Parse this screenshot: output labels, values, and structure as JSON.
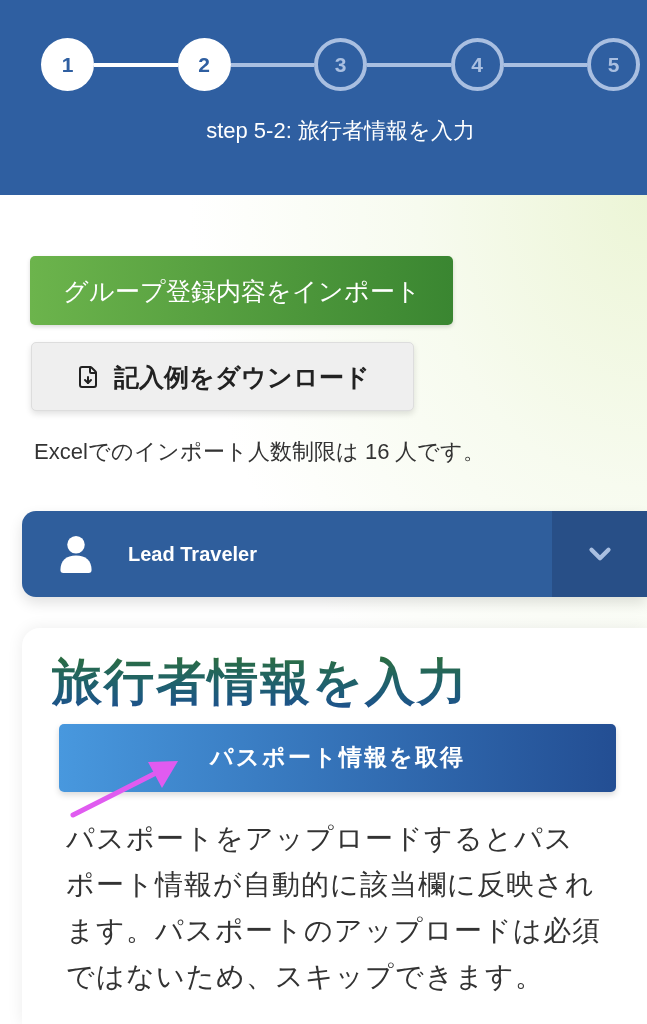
{
  "stepper": {
    "steps": [
      {
        "label": "1",
        "completed": true
      },
      {
        "label": "2",
        "completed": true
      },
      {
        "label": "3",
        "completed": false
      },
      {
        "label": "4",
        "completed": false
      },
      {
        "label": "5",
        "completed": false
      }
    ],
    "caption": "step 5-2: 旅行者情報を入力"
  },
  "import_button": "グループ登録内容をインポート",
  "download_button": "記入例をダウンロード",
  "import_limit_note": "Excelでのインポート人数制限は 16 人です。",
  "traveler_accordion": {
    "title": "Lead Traveler"
  },
  "form_card": {
    "heading": "旅行者情報を入力",
    "passport_button": "パスポート情報を取得",
    "description": "パスポートをアップロードするとパスポート情報が自動的に該当欄に反映されます。パスポートのアップロードは必須ではないため、スキップできます。"
  }
}
